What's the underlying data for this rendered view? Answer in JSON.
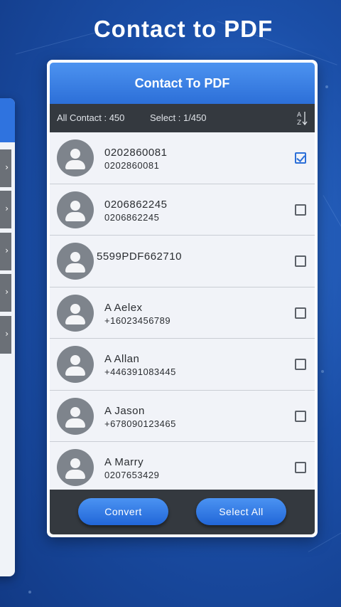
{
  "headline": "Contact to PDF",
  "app": {
    "title": "Contact To PDF",
    "all_contact": "All Contact : 450",
    "select_count": "Select : 1/450",
    "sort_icon": "sort-alpha-icon"
  },
  "contacts": [
    {
      "name": "0202860081",
      "number": "0202860081",
      "checked": true
    },
    {
      "name": "0206862245",
      "number": "0206862245",
      "checked": false
    },
    {
      "name": "5599PDF662710",
      "number": "",
      "checked": false
    },
    {
      "name": "A Aelex",
      "number": "+16023456789",
      "checked": false
    },
    {
      "name": "A Allan",
      "number": "+446391083445",
      "checked": false
    },
    {
      "name": "A Jason",
      "number": "+678090123465",
      "checked": false
    },
    {
      "name": "A Marry",
      "number": "0207653429",
      "checked": false
    }
  ],
  "footer": {
    "convert_label": "Convert",
    "select_all_label": "Select All"
  },
  "colors": {
    "accent": "#2c6fd8",
    "bar": "#34393f",
    "background": "#1b4fa8"
  }
}
